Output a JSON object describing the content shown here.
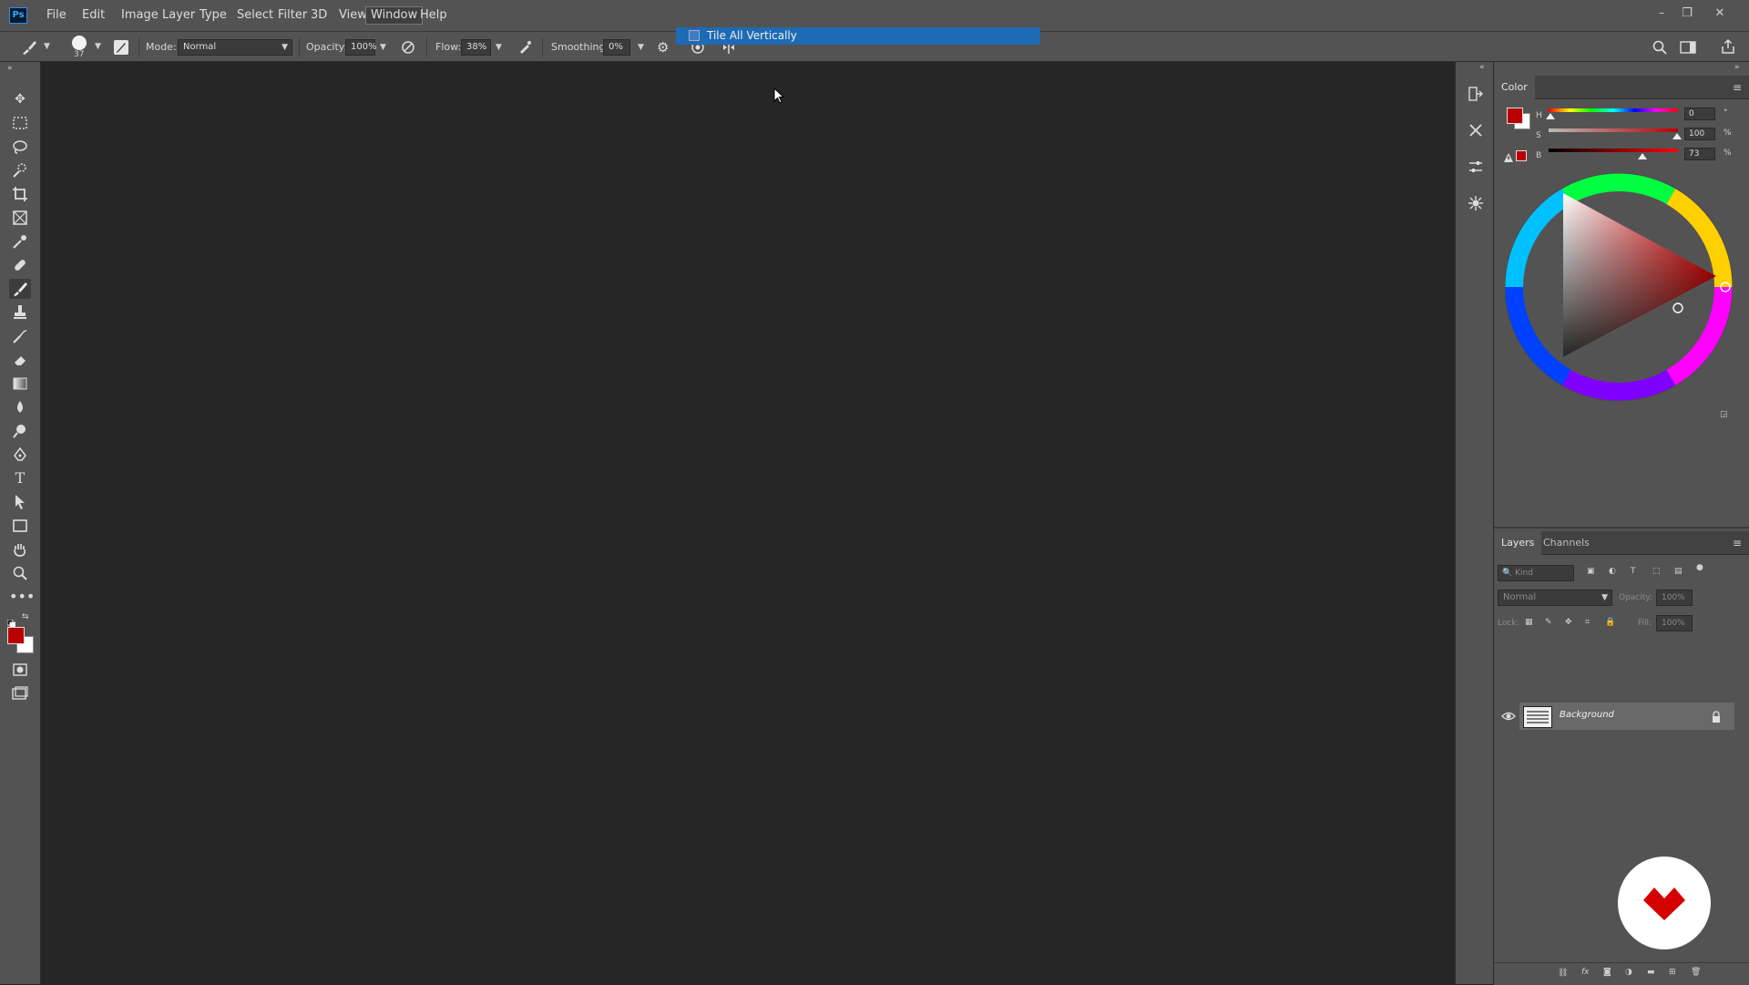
{
  "app": {
    "logo": "Ps"
  },
  "menu": [
    "File",
    "Edit",
    "Image",
    "Layer",
    "Type",
    "Select",
    "Filter",
    "3D",
    "View",
    "Window",
    "Help"
  ],
  "window_controls": {
    "minimize": "–",
    "restore": "❐",
    "close": "✕"
  },
  "options": {
    "brush_size": "37",
    "mode_label": "Mode:",
    "mode_value": "Normal",
    "opacity_label": "Opacity:",
    "opacity_value": "100%",
    "flow_label": "Flow:",
    "flow_value": "38%",
    "smoothing_label": "Smoothing:",
    "smoothing_value": "0%"
  },
  "dropdown_item": "Tile All Vertically",
  "color_panel": {
    "tab": "Color",
    "h_label": "H",
    "h_value": "0",
    "h_unit": "°",
    "s_label": "S",
    "s_value": "100",
    "s_unit": "%",
    "b_label": "B",
    "b_value": "73",
    "b_unit": "%",
    "foreground": "#ba0000",
    "background": "#ffffff"
  },
  "layers_panel": {
    "tab_layers": "Layers",
    "tab_channels": "Channels",
    "filter_kind": "Kind",
    "blend_mode": "Normal",
    "opacity_label": "Opacity:",
    "opacity_value": "100%",
    "lock_label": "Lock:",
    "fill_label": "Fill:",
    "fill_value": "100%",
    "layer_name": "Background"
  }
}
